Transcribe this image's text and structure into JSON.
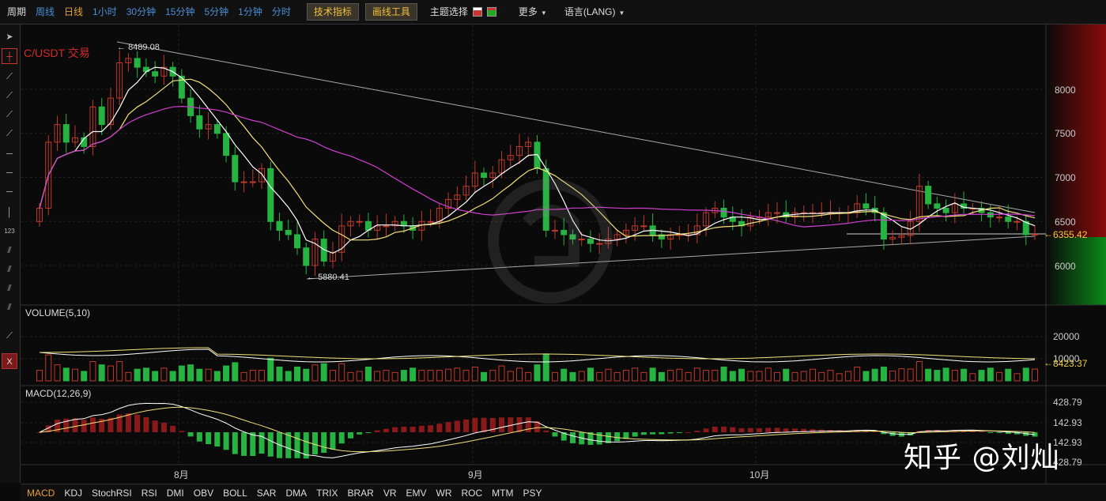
{
  "toolbar": {
    "period_label": "周期",
    "periods": [
      "周线",
      "日线",
      "1小时",
      "30分钟",
      "15分钟",
      "5分钟",
      "1分钟",
      "分时"
    ],
    "active_period": "日线",
    "indicators_btn": "技术指标",
    "drawing_btn": "画线工具",
    "theme_label": "主题选择",
    "more_label": "更多",
    "lang_label": "语言(LANG)"
  },
  "chart": {
    "title": "C/USDT 交易",
    "high_label": "8489.08",
    "low_label": "5880.41",
    "last_price": "6355.42",
    "price_ticks": [
      "8000",
      "7500",
      "7000",
      "6500",
      "6000"
    ],
    "x_ticks": [
      "8月",
      "9月",
      "10月"
    ]
  },
  "volume": {
    "title": "VOLUME(5,10)",
    "ticks": [
      "20000",
      "10000"
    ],
    "last_value": "8423.37"
  },
  "macd": {
    "title": "MACD(12,26,9)",
    "ticks": [
      "428.79",
      "142.93",
      "142.93",
      "428.79"
    ]
  },
  "tabs": [
    "MACD",
    "KDJ",
    "StochRSI",
    "RSI",
    "DMI",
    "OBV",
    "BOLL",
    "SAR",
    "DMA",
    "TRIX",
    "BRAR",
    "VR",
    "EMV",
    "WR",
    "ROC",
    "MTM",
    "PSY"
  ],
  "active_tab": "MACD",
  "watermark": "知乎 @刘灿",
  "colors": {
    "up": "#c0392b",
    "down": "#27b342",
    "ma5": "#ffffff",
    "ma10": "#f3e07a",
    "ma30": "#d03fd0",
    "accent": "#e8a03a"
  },
  "chart_data": {
    "type": "candlestick",
    "close": [
      6650,
      7400,
      7600,
      7400,
      7450,
      7350,
      7800,
      7600,
      7900,
      8300,
      8350,
      8250,
      8200,
      8150,
      8250,
      8150,
      7900,
      7700,
      7550,
      7600,
      7500,
      7250,
      6950,
      6950,
      6950,
      7100,
      6500,
      6400,
      6350,
      6200,
      6000,
      6300,
      6050,
      6150,
      6450,
      6500,
      6500,
      6400,
      6450,
      6450,
      6500,
      6450,
      6400,
      6500,
      6500,
      6650,
      6750,
      6800,
      6900,
      7050,
      7000,
      7050,
      7200,
      7250,
      7350,
      7400,
      7100,
      6400,
      6400,
      6350,
      6300,
      6300,
      6250,
      6250,
      6300,
      6350,
      6400,
      6450,
      6450,
      6350,
      6300,
      6350,
      6350,
      6350,
      6450,
      6600,
      6650,
      6550,
      6500,
      6450,
      6550,
      6550,
      6600,
      6600,
      6550,
      6600,
      6600,
      6600,
      6600,
      6600,
      6600,
      6600,
      6700,
      6650,
      6600,
      6300,
      6320,
      6340,
      6500,
      6900,
      6700,
      6650,
      6600,
      6700,
      6650,
      6650,
      6600,
      6550,
      6550,
      6500,
      6500,
      6350,
      6355
    ]
  }
}
